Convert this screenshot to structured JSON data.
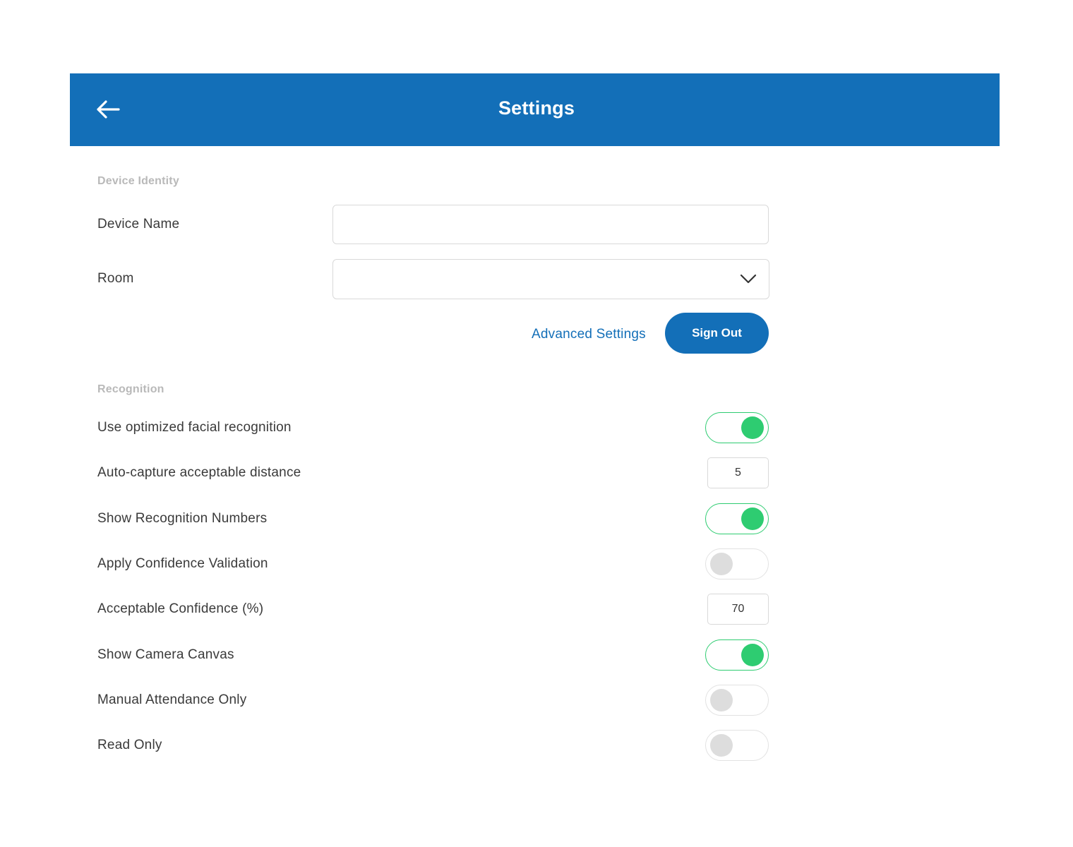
{
  "header": {
    "title": "Settings",
    "back_icon": "arrow-left-icon",
    "background": "#136fb8"
  },
  "device_identity": {
    "section_title": "Device Identity",
    "device_name": {
      "label": "Device Name",
      "value": "",
      "placeholder": ""
    },
    "room": {
      "label": "Room",
      "value": "",
      "icon": "chevron-down-icon"
    },
    "advanced_settings_label": "Advanced Settings",
    "sign_out_label": "Sign Out"
  },
  "recognition": {
    "section_title": "Recognition",
    "optimized_facial": {
      "label": "Use optimized facial recognition",
      "enabled": true
    },
    "auto_capture_distance": {
      "label": "Auto-capture acceptable distance",
      "value": "5"
    },
    "show_recognition_numbers": {
      "label": "Show Recognition Numbers",
      "enabled": true
    },
    "apply_confidence_validation": {
      "label": "Apply Confidence Validation",
      "enabled": false
    },
    "acceptable_confidence": {
      "label": "Acceptable Confidence (%)",
      "value": "70"
    },
    "show_camera_canvas": {
      "label": "Show Camera Canvas",
      "enabled": true
    },
    "manual_attendance_only": {
      "label": "Manual Attendance Only",
      "enabled": false
    },
    "read_only": {
      "label": "Read Only",
      "enabled": false
    }
  },
  "colors": {
    "accent": "#136fb8",
    "toggle_on": "#2ecc71",
    "toggle_off_knob": "#dddddd",
    "section_title": "#b9b9b9"
  }
}
